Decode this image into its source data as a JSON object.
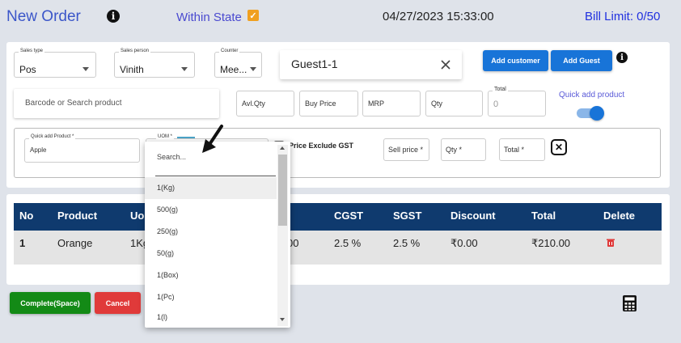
{
  "header": {
    "title": "New Order",
    "within_state": "Within State",
    "datetime": "04/27/2023 15:33:00",
    "bill_limit": "Bill Limit: 0/50"
  },
  "form": {
    "sales_type": {
      "label": "Sales type",
      "value": "Pos"
    },
    "sales_person": {
      "label": "Sales person",
      "value": "Vinith"
    },
    "counter": {
      "label": "Counter",
      "value": "Mee..."
    },
    "customer": {
      "value": "Guest1-1"
    },
    "add_customer": "Add customer",
    "add_guest": "Add Guest",
    "barcode_placeholder": "Barcode or Search product",
    "avl_qty": "Avl.Qty",
    "buy_price": "Buy Price",
    "mrp": "MRP",
    "qty": "Qty",
    "total_label": "Total",
    "total_value": "0",
    "quick_add_label": "Quick add product"
  },
  "quick_add": {
    "product_label": "Quick add Product *",
    "product_value": "Apple",
    "uom_label": "UOM *",
    "price_exclude_gst": "Price Exclude GST",
    "sell_price": "Sell price *",
    "qty": "Qty *",
    "total": "Total *"
  },
  "table": {
    "headers": [
      "No",
      "Product",
      "Uom",
      "",
      "CGST",
      "SGST",
      "Discount",
      "Total",
      "Delete"
    ],
    "rows": [
      {
        "no": "1",
        "product": "Orange",
        "uom": "1Kg",
        "rate_tail": "00",
        "cgst": "2.5 %",
        "sgst": "2.5 %",
        "discount": "₹0.00",
        "total": "₹210.00"
      }
    ]
  },
  "footer": {
    "complete": "Complete(Space)",
    "cancel": "Cancel"
  },
  "uom_dropdown": {
    "search_placeholder": "Search...",
    "options": [
      "1(Kg)",
      "500(g)",
      "250(g)",
      "50(g)",
      "1(Box)",
      "1(Pc)",
      "1(l)"
    ],
    "highlighted_index": 0
  },
  "colors": {
    "accent": "#1874d8",
    "header_bg": "#0f3a6e",
    "complete": "#138a16",
    "cancel": "#e03a3a"
  }
}
